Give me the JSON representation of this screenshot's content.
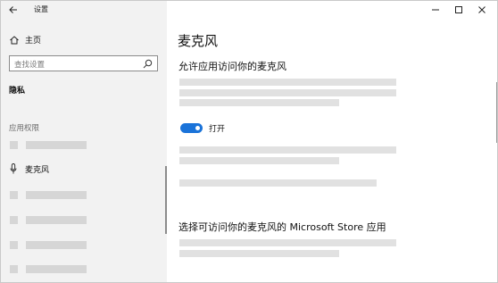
{
  "window": {
    "app_title": "设置"
  },
  "sidebar": {
    "home_label": "主页",
    "search_placeholder": "查找设置",
    "privacy_label": "隐私",
    "permissions_header": "应用权限",
    "active_item_label": "麦克风"
  },
  "main": {
    "page_title": "麦克风",
    "allow_heading": "允许应用访问你的麦克风",
    "toggle_label": "打开",
    "toggle_on": true,
    "store_heading": "选择可访问你的麦克风的 Microsoft Store 应用"
  },
  "colors": {
    "accent": "#1a73d9",
    "sidebar_bg": "#f2f2f2",
    "placeholder_bar": "#e1e1e1"
  },
  "icons": [
    "back-arrow-icon",
    "home-icon",
    "search-icon",
    "microphone-icon",
    "minimize-icon",
    "maximize-icon",
    "close-icon"
  ]
}
